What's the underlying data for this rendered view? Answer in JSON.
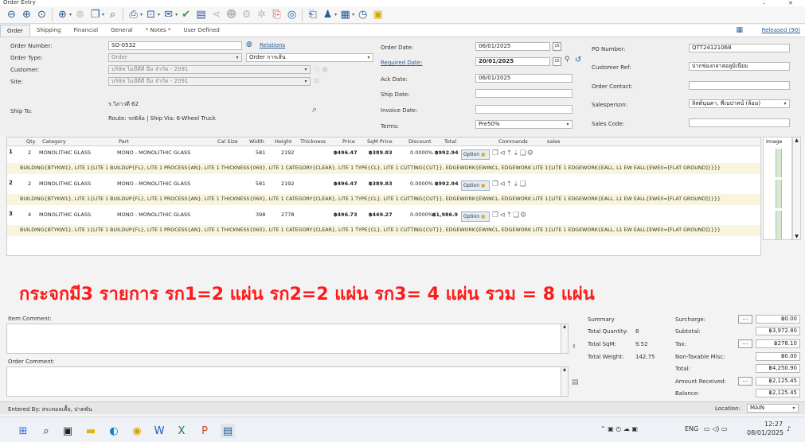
{
  "window": {
    "title": "Order Entry",
    "minimize": "–",
    "close": "✕"
  },
  "tabs": [
    "Order",
    "Shipping",
    "Financial",
    "General",
    "* Notes *",
    "User Defined"
  ],
  "status_link": "Released (90)",
  "header": {
    "order_number_label": "Order Number:",
    "order_number": "SO-0532",
    "relations": "Relations",
    "order_type_label": "Order Type:",
    "order_type": "Order",
    "order_type2": "Order การเส้น",
    "customer_label": "Customer:",
    "customer": "บริษัท ไมมีดีดี อีม จำกัด - 2091",
    "site_label": "Site:",
    "site": "บริษัท ไมมีดีดี อีม จำกัด - 2091",
    "ship_to_label": "Ship To:",
    "ship_to_name": "ร.วิภาวดี 62",
    "route_text": "Route: รถ6ล้อ  |  Ship Via: 6-Wheel Truck",
    "order_date_label": "Order Date:",
    "order_date": "06/01/2025",
    "required_date_label": "Required Date:",
    "required_date": "20/01/2025",
    "ack_date_label": "Ack Date:",
    "ack_date": "06/01/2025",
    "ship_date_label": "Ship Date:",
    "ship_date": "",
    "invoice_date_label": "Invoice Date:",
    "invoice_date": "",
    "terms_label": "Terms:",
    "terms": "Pre50%",
    "cal15": "15",
    "po_number_label": "PO Number:",
    "po_number": "QTT24121068",
    "customer_ref_label": "Customer Ref:",
    "customer_ref": "ปากช่องกลาสอลูมิเนียม",
    "order_contact_label": "Order Contact:",
    "order_contact": "",
    "salesperson_label": "Salesperson:",
    "salesperson": "ลิสต์นุนคา, พีเนปาทน์ (ล้อม)",
    "sales_code_label": "Sales Code:",
    "sales_code": ""
  },
  "grid": {
    "columns": [
      "Qty",
      "Category",
      "Part",
      "Cal Size",
      "Width",
      "Height",
      "Thickness",
      "Price",
      "SqM Price",
      "Discount",
      "Total",
      "Commands",
      "sales",
      "Image"
    ],
    "option_label": "Option",
    "rows": [
      {
        "num": "1",
        "qty": "2",
        "category": "MONOLITHIC GLASS",
        "part": "MONO - MONOLITHIC GLASS",
        "width": "581",
        "height": "2192",
        "price": "฿496.47",
        "sqm_price": "฿389.83",
        "discount": "0.0000%",
        "total": "฿992.94",
        "desc": "BUILDING{BTYKW1}, LITE 1{LITE 1 BUILDUP{FL}, LITE 1 PROCESS{AN}, LITE 1 THICKNESS{060}, LITE 1 CATEGORY{CLEAR}, LITE 1 TYPE{CL}, LITE 1 CUTTING{CUT}}, EDGEWORK{EWINCL, EDGEWORK LITE 1{LITE 1 EDGEWORK{EALL, L1 EW EALL{EWE0=[FLAT GROUND]}}}}"
      },
      {
        "num": "2",
        "qty": "2",
        "category": "MONOLITHIC GLASS",
        "part": "MONO - MONOLITHIC GLASS",
        "width": "581",
        "height": "2192",
        "price": "฿496.47",
        "sqm_price": "฿389.83",
        "discount": "0.0000%",
        "total": "฿992.94",
        "desc": "BUILDING{BTYKW1}, LITE 1{LITE 1 BUILDUP{FL}, LITE 1 PROCESS{AN}, LITE 1 THICKNESS{060}, LITE 1 CATEGORY{CLEAR}, LITE 1 TYPE{CL}, LITE 1 CUTTING{CUT}}, EDGEWORK{EWINCL, EDGEWORK LITE 1{LITE 1 EDGEWORK{EALL, L1 EW EALL{EWE0=[FLAT GROUND]}}}}"
      },
      {
        "num": "3",
        "qty": "4",
        "category": "MONOLITHIC GLASS",
        "part": "MONO - MONOLITHIC GLASS",
        "width": "398",
        "height": "2778",
        "price": "฿496.73",
        "sqm_price": "฿449.27",
        "discount": "0.0000%",
        "total": "฿1,986.9",
        "desc": "BUILDING{BTYKW1}, LITE 1{LITE 1 BUILDUP{FL}, LITE 1 PROCESS{AN}, LITE 1 THICKNESS{060}, LITE 1 CATEGORY{CLEAR}, LITE 1 TYPE{CL}, LITE 1 CUTTING{CUT}}, EDGEWORK{EWINCL, EDGEWORK LITE 1{LITE 1 EDGEWORK{EALL, L1 EW EALL{EWE0=[FLAT GROUND]}}}}"
      }
    ]
  },
  "annotation": "กระจกมี3 รายการ    รก1=2 แผ่น   รก2=2 แผ่น  รก3= 4 แผ่น     รวม = 8 แผ่น",
  "comments": {
    "item_label": "Item Comment:",
    "order_label": "Order Comment:"
  },
  "summary": {
    "title": "Summary",
    "total_qty_label": "Total Quantity:",
    "total_qty": "8",
    "total_sqm_label": "Total SqM:",
    "total_sqm": "9.52",
    "total_weight_label": "Total Weight:",
    "total_weight": "142.75",
    "surcharge_label": "Surcharge:",
    "surcharge": "฿0.00",
    "subtotal_label": "Subtotal:",
    "subtotal": "฿3,972.80",
    "tax_label": "Tax:",
    "tax": "฿278.10",
    "nontax_label": "Non-Taxable Misc:",
    "nontax": "฿0.00",
    "total_label": "Total:",
    "total": "฿4,250.90",
    "amount_received_label": "Amount Received:",
    "amount_received": "฿2,125.45",
    "balance_label": "Balance:",
    "balance": "฿2,125.45",
    "dots": "..."
  },
  "statusbar": {
    "entered_by": "Entered By: สระทอลเคื้ย, ปาตพัน",
    "location_label": "Location:",
    "location": "MAIN"
  },
  "taskbar": {
    "lang": "ENG",
    "time": "12:27",
    "date": "08/01/2025"
  }
}
